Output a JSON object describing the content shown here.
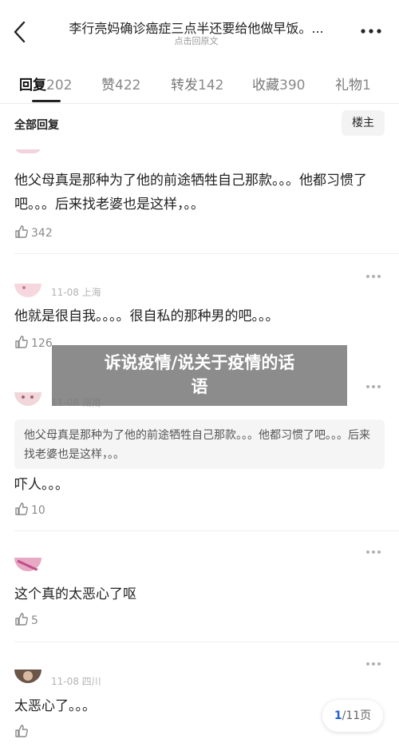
{
  "header": {
    "title": "李行亮妈确诊癌症三点半还要给他做早饭。...",
    "subtitle": "点击回原文"
  },
  "tabs": [
    {
      "label": "回复",
      "count": "202",
      "active": true
    },
    {
      "label": "赞",
      "count": "422"
    },
    {
      "label": "转发",
      "count": "142"
    },
    {
      "label": "收藏",
      "count": "390"
    },
    {
      "label": "礼物",
      "count": "1"
    }
  ],
  "sort": {
    "label": "全部回复",
    "floor_button": "楼主"
  },
  "comments": [
    {
      "text": "他父母真是那种为了他的前途牺牲自己那款。。。他都习惯了吧。。。后来找老婆也是这样，。。",
      "likes": "342"
    },
    {
      "meta": "11-08 上海",
      "text": "他就是很自我。。。。很自私的那种男的吧。。。",
      "likes": "126"
    },
    {
      "meta": "11-08 湖南",
      "quote": "他父母真是那种为了他的前途牺牲自己那款。。。他都习惯了吧。。。后来找老婆也是这样，。。",
      "text": "吓人。。。",
      "likes": "10"
    },
    {
      "text": "这个真的太恶心了呕",
      "likes": "5"
    },
    {
      "meta": "11-08 四川",
      "text": "太恶心了。。。",
      "likes": ""
    }
  ],
  "overlay": {
    "line1": "诉说疫情/说关于疫情的话",
    "line2": "语"
  },
  "pager": {
    "current": "1",
    "total": "/11页"
  }
}
